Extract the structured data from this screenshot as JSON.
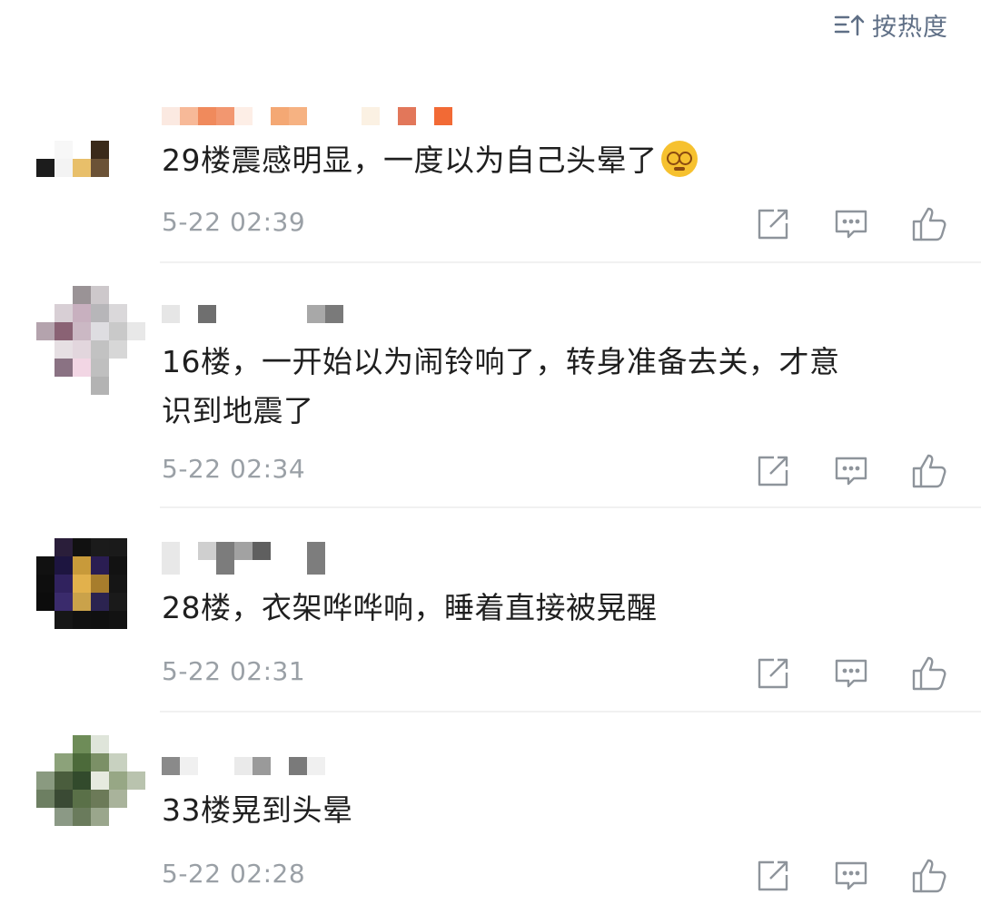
{
  "sort": {
    "label": "按热度",
    "icon": "sort-icon"
  },
  "comments": [
    {
      "text": "29楼震感明显，一度以为自己头晕了",
      "has_emoji": true,
      "emoji": "dizzy-face-emoji",
      "time": "5-22 02:39"
    },
    {
      "text_line1": "16楼，一开始以为闹铃响了，转身准备去关，才意",
      "text_line2": "识到地震了",
      "time": "5-22 02:34"
    },
    {
      "text": "28楼，衣架哗哗响，睡着直接被晃醒",
      "time": "5-22 02:31"
    },
    {
      "text": "33楼晃到头晕",
      "time": "5-22 02:28"
    }
  ],
  "actions": [
    "share-icon",
    "comment-icon",
    "like-icon"
  ],
  "colors": {
    "sort_text": "#5f6f86",
    "time_text": "#9aa0a6",
    "icon_gray": "#8e949b"
  }
}
